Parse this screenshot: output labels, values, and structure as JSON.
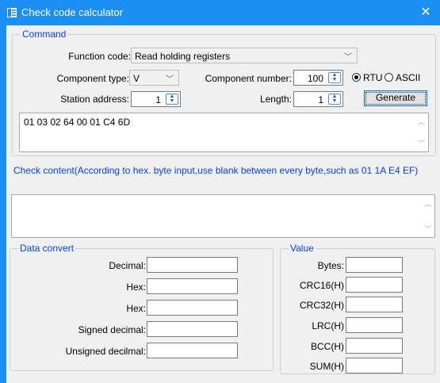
{
  "window": {
    "title": "Check code calculator",
    "close_glyph": "✕"
  },
  "command": {
    "legend": "Command",
    "function_code_label": "Function code:",
    "function_code_value": "Read holding registers",
    "component_type_label": "Component type:",
    "component_type_value": "V",
    "component_number_label": "Component number:",
    "component_number_value": "100",
    "station_address_label": "Station address:",
    "station_address_value": "1",
    "length_label": "Length:",
    "length_value": "1",
    "rtu_label": "RTU",
    "ascii_label": "ASCII",
    "selected_mode": "RTU",
    "generate_label": "Generate",
    "output": "01 03 02 64 00 01 C4 6D"
  },
  "check_hint": "Check content(According to hex. byte input,use blank between every byte,such as 01 1A E4 EF)",
  "check_input": "",
  "data_convert": {
    "legend": "Data convert",
    "fields": [
      {
        "label": "Decimal:",
        "value": ""
      },
      {
        "label": "Hex:",
        "value": ""
      },
      {
        "label": "Hex:",
        "value": ""
      },
      {
        "label": "Signed decimal:",
        "value": ""
      },
      {
        "label": "Unsigned decilmal:",
        "value": ""
      }
    ]
  },
  "value": {
    "legend": "Value",
    "fields": [
      {
        "label": "Bytes:",
        "value": ""
      },
      {
        "label": "CRC16(H)",
        "value": ""
      },
      {
        "label": "CRC32(H)",
        "value": ""
      },
      {
        "label": "LRC(H)",
        "value": ""
      },
      {
        "label": "BCC(H)",
        "value": ""
      },
      {
        "label": "SUM(H)",
        "value": ""
      }
    ]
  },
  "colors": {
    "titlebar": "#1c8ff5",
    "legend": "#0040ff",
    "client": "#f0f0f0"
  },
  "icons": {
    "app": "app-icon",
    "chevron": "chevron-down-icon",
    "spin": "spin-arrows-icon"
  }
}
